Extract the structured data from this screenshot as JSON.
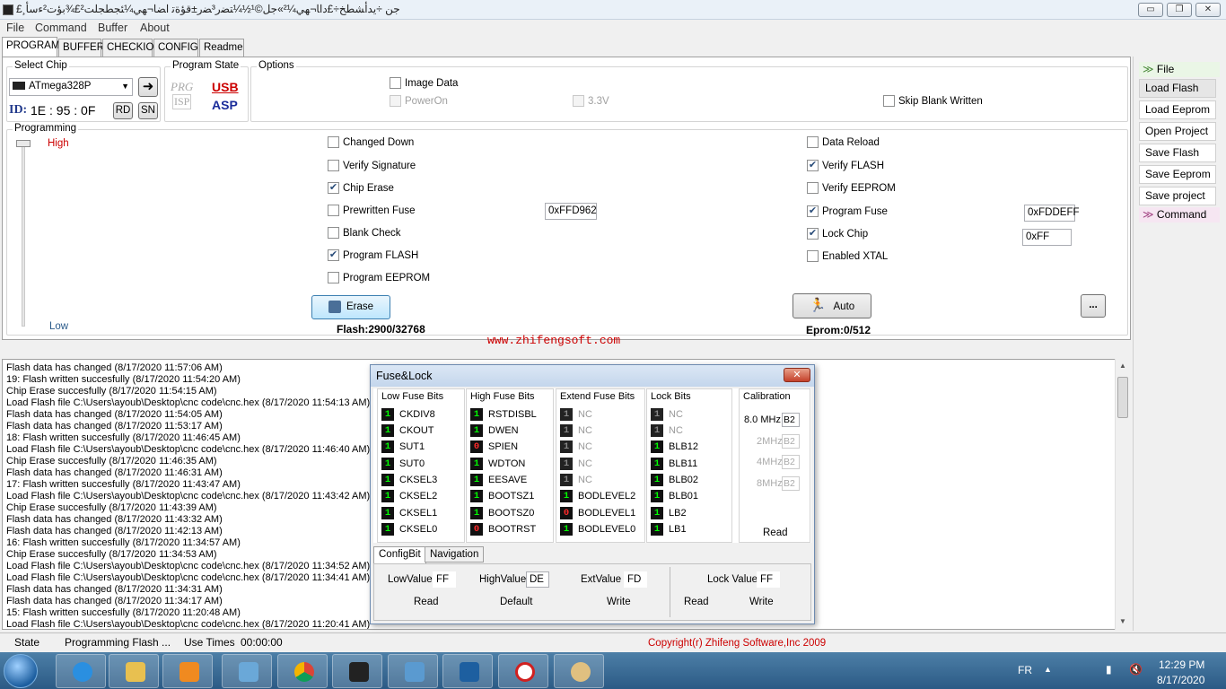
{
  "window": {
    "title": "£¸ﺟﻦ ÷ﻳﺪأﺸﻄﺦ÷£ﺩﺍﺎ¬ﻬﻲ¼²»ﺟﻞ©¹½¼ﺘﻀﺭ³ﻀﺭ±ﻗﺆﺓﺗ ﺍﻀﺎ¬ﻬﻲ¼ﺌﺠﻄﺠﻠﺖ²£¾ﺑﺆﺕ²ﺀﺳﺄ",
    "controls": {
      "minimize": "▭",
      "restore": "❐",
      "close": "✕"
    }
  },
  "menu": [
    "File",
    "Command",
    "Buffer",
    "About"
  ],
  "tabs": [
    "PROGRAM",
    "BUFFER",
    "CHECKIO",
    "CONFIG",
    "Readme"
  ],
  "select_chip": {
    "label": "Select Chip",
    "chip": "ATmega328P",
    "id_label": "ID:",
    "id_value": "1E : 95 : 0F",
    "rd": "RD",
    "sn": "SN"
  },
  "program_state": {
    "label": "Program State",
    "prg": "PRG",
    "isp": "ISP",
    "usb": "USB",
    "asp": "ASP"
  },
  "options": {
    "label": "Options",
    "image_data": "Image Data",
    "power_on": "PowerOn",
    "v33": "3.3V",
    "skip_blank": "Skip Blank Written"
  },
  "programming": {
    "label": "Programming",
    "high": "High",
    "low": "Low",
    "left_checks": [
      {
        "label": "Changed Down",
        "checked": false
      },
      {
        "label": "Verify Signature",
        "checked": false
      },
      {
        "label": "Chip Erase",
        "checked": true
      },
      {
        "label": "Prewritten Fuse",
        "checked": false
      },
      {
        "label": "Blank Check",
        "checked": false
      },
      {
        "label": "Program FLASH",
        "checked": true
      },
      {
        "label": "Program EEPROM",
        "checked": false
      }
    ],
    "right_checks": [
      {
        "label": "Data Reload",
        "checked": false
      },
      {
        "label": "Verify FLASH",
        "checked": true
      },
      {
        "label": "Verify EEPROM",
        "checked": false
      },
      {
        "label": "Program Fuse",
        "checked": true
      },
      {
        "label": "Lock Chip",
        "checked": true
      },
      {
        "label": "Enabled XTAL",
        "checked": false
      }
    ],
    "prewritten_value": "0xFFD962",
    "fuse_value": "0xFDDEFF",
    "lock_value": "0xFF",
    "erase": "Erase",
    "auto": "Auto",
    "more": "...",
    "flash_info": "Flash:2900/32768",
    "eprom_info": "Eprom:0/512",
    "website": "www.zhifengsoft.com"
  },
  "sidebar": {
    "file_header": "File",
    "buttons": [
      "Load Flash",
      "Load Eeprom",
      "Open Project",
      "Save Flash",
      "Save Eeprom",
      "Save project"
    ],
    "command_header": "Command"
  },
  "log": [
    "Flash data has changed (8/17/2020 11:57:06 AM)",
    "19: Flash written succesfully (8/17/2020 11:54:20 AM)",
    "Chip Erase succesfully (8/17/2020 11:54:15 AM)",
    "Load Flash file C:\\Users\\ayoub\\Desktop\\cnc code\\cnc.hex (8/17/2020 11:54:13 AM)",
    "Flash data has changed (8/17/2020 11:54:05 AM)",
    "Flash data has changed (8/17/2020 11:53:17 AM)",
    "18: Flash written succesfully (8/17/2020 11:46:45 AM)",
    "Load Flash file C:\\Users\\ayoub\\Desktop\\cnc code\\cnc.hex (8/17/2020 11:46:40 AM)",
    "Chip Erase succesfully (8/17/2020 11:46:35 AM)",
    "Flash data has changed (8/17/2020 11:46:31 AM)",
    "17: Flash written succesfully (8/17/2020 11:43:47 AM)",
    "Load Flash file C:\\Users\\ayoub\\Desktop\\cnc code\\cnc.hex (8/17/2020 11:43:42 AM)",
    "Chip Erase succesfully (8/17/2020 11:43:39 AM)",
    "Flash data has changed (8/17/2020 11:43:32 AM)",
    "Flash data has changed (8/17/2020 11:42:13 AM)",
    "16: Flash written succesfully (8/17/2020 11:34:57 AM)",
    "Chip Erase succesfully (8/17/2020 11:34:53 AM)",
    "Load Flash file C:\\Users\\ayoub\\Desktop\\cnc code\\cnc.hex (8/17/2020 11:34:52 AM)",
    "Load Flash file C:\\Users\\ayoub\\Desktop\\cnc code\\cnc.hex (8/17/2020 11:34:41 AM)",
    "Flash data has changed (8/17/2020 11:34:31 AM)",
    "Flash data has changed (8/17/2020 11:34:17 AM)",
    "15: Flash written succesfully (8/17/2020 11:20:48 AM)",
    "Load Flash file C:\\Users\\ayoub\\Desktop\\cnc code\\cnc.hex (8/17/2020 11:20:41 AM)"
  ],
  "status": {
    "state": "State",
    "msg": "Programming Flash ...",
    "use_times": "Use Times",
    "time": "00:00:00",
    "copyright": "Copyright(r) Zhifeng Software,Inc 2009"
  },
  "fuse_dialog": {
    "title": "Fuse&Lock",
    "groups": [
      {
        "header": "Low Fuse Bits",
        "bits": [
          {
            "v": "1",
            "name": "CKDIV8"
          },
          {
            "v": "1",
            "name": "CKOUT"
          },
          {
            "v": "1",
            "name": "SUT1"
          },
          {
            "v": "1",
            "name": "SUT0"
          },
          {
            "v": "1",
            "name": "CKSEL3"
          },
          {
            "v": "1",
            "name": "CKSEL2"
          },
          {
            "v": "1",
            "name": "CKSEL1"
          },
          {
            "v": "1",
            "name": "CKSEL0"
          }
        ]
      },
      {
        "header": "High Fuse Bits",
        "bits": [
          {
            "v": "1",
            "name": "RSTDISBL"
          },
          {
            "v": "1",
            "name": "DWEN"
          },
          {
            "v": "0",
            "name": "SPIEN"
          },
          {
            "v": "1",
            "name": "WDTON"
          },
          {
            "v": "1",
            "name": "EESAVE"
          },
          {
            "v": "1",
            "name": "BOOTSZ1"
          },
          {
            "v": "1",
            "name": "BOOTSZ0"
          },
          {
            "v": "0",
            "name": "BOOTRST"
          }
        ]
      },
      {
        "header": "Extend Fuse Bits",
        "bits": [
          {
            "v": "1",
            "name": "NC",
            "dim": true
          },
          {
            "v": "1",
            "name": "NC",
            "dim": true
          },
          {
            "v": "1",
            "name": "NC",
            "dim": true
          },
          {
            "v": "1",
            "name": "NC",
            "dim": true
          },
          {
            "v": "1",
            "name": "NC",
            "dim": true
          },
          {
            "v": "1",
            "name": "BODLEVEL2"
          },
          {
            "v": "0",
            "name": "BODLEVEL1"
          },
          {
            "v": "1",
            "name": "BODLEVEL0"
          }
        ]
      },
      {
        "header": "Lock Bits",
        "bits": [
          {
            "v": "1",
            "name": "NC",
            "dim": true
          },
          {
            "v": "1",
            "name": "NC",
            "dim": true
          },
          {
            "v": "1",
            "name": "BLB12"
          },
          {
            "v": "1",
            "name": "BLB11"
          },
          {
            "v": "1",
            "name": "BLB02"
          },
          {
            "v": "1",
            "name": "BLB01"
          },
          {
            "v": "1",
            "name": "LB2"
          },
          {
            "v": "1",
            "name": "LB1"
          }
        ]
      }
    ],
    "calibration": {
      "header": "Calibration",
      "rows": [
        {
          "label": "8.0 MHz",
          "value": "B2",
          "dim": false
        },
        {
          "label": "2MHz",
          "value": "B2",
          "dim": true
        },
        {
          "label": "4MHz",
          "value": "B2",
          "dim": true
        },
        {
          "label": "8MHz",
          "value": "B2",
          "dim": true
        }
      ],
      "read": "Read"
    },
    "tabs": [
      "ConfigBit",
      "Navigation"
    ],
    "low_label": "LowValue",
    "low_value": "FF",
    "high_label": "HighValue",
    "high_value": "DE",
    "ext_label": "ExtValue",
    "ext_value": "FD",
    "lock_label": "Lock Value",
    "lock_value": "FF",
    "read": "Read",
    "default": "Default",
    "write": "Write",
    "lock_read": "Read",
    "lock_write": "Write"
  },
  "taskbar": {
    "lang": "FR",
    "time": "12:29 PM",
    "date": "8/17/2020",
    "apps": [
      "ie",
      "explorer",
      "media",
      "tool",
      "chrome",
      "chip",
      "photos",
      "programmer",
      "clock",
      "paint"
    ]
  },
  "colors": {
    "accent_red": "#cc0000",
    "bit_one": "#00ff00",
    "bit_zero": "#ff2a2a"
  }
}
